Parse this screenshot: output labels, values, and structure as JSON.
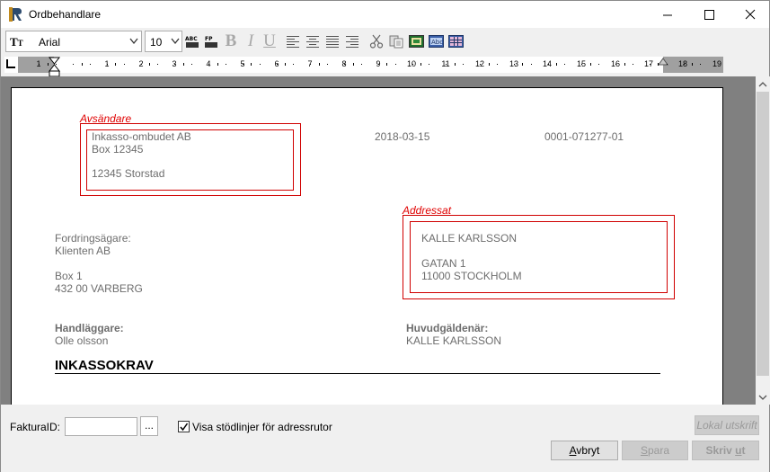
{
  "window": {
    "title": "Ordbehandlare"
  },
  "toolbar": {
    "font_name": "Arial",
    "font_size": "10",
    "icons": [
      "font-type-icon",
      "spellcheck-icon",
      "field-insert-icon",
      "bold-icon",
      "italic-icon",
      "underline-icon",
      "align-left-icon",
      "align-center-icon",
      "align-justify-icon",
      "align-right-icon",
      "cut-icon",
      "paste-icon",
      "image-insert-icon",
      "text-box-icon",
      "table-icon"
    ]
  },
  "ruler": {
    "numbers": [
      "1",
      "1",
      "2",
      "3",
      "4",
      "5",
      "6",
      "7",
      "8",
      "9",
      "10",
      "11",
      "12",
      "13",
      "14",
      "15",
      "16",
      "17",
      "18",
      "19"
    ]
  },
  "document": {
    "sender_label": "Avsändare",
    "sender_lines": [
      "Inkasso-ombudet AB",
      "Box 12345",
      "12345 Storstad"
    ],
    "date": "2018-03-15",
    "reference": "0001-071277-01",
    "addressee_label": "Addressat",
    "addressee_lines": [
      "KALLE KARLSSON",
      "GATAN 1",
      "11000  STOCKHOLM"
    ],
    "creditor_label": "Fordringsägare:",
    "creditor_name": "Klienten AB",
    "creditor_address": [
      "Box 1",
      "432 00 VARBERG"
    ],
    "handler_label": "Handläggare:",
    "handler_name": "Olle olsson",
    "debtor_label": "Huvudgäldenär:",
    "debtor_name": "KALLE KARLSSON",
    "heading": "INKASSOKRAV"
  },
  "bottom": {
    "faktura_label": "FakturaID:",
    "faktura_value": "",
    "dots_label": "...",
    "checkbox_label": "Visa stödlinjer för adressrutor",
    "checkbox_checked": true,
    "lokal_label": "Lokal utskrift",
    "avbryt_label": "Avbryt",
    "spara_label": "Spara",
    "skriv_label": "Skriv ut"
  }
}
